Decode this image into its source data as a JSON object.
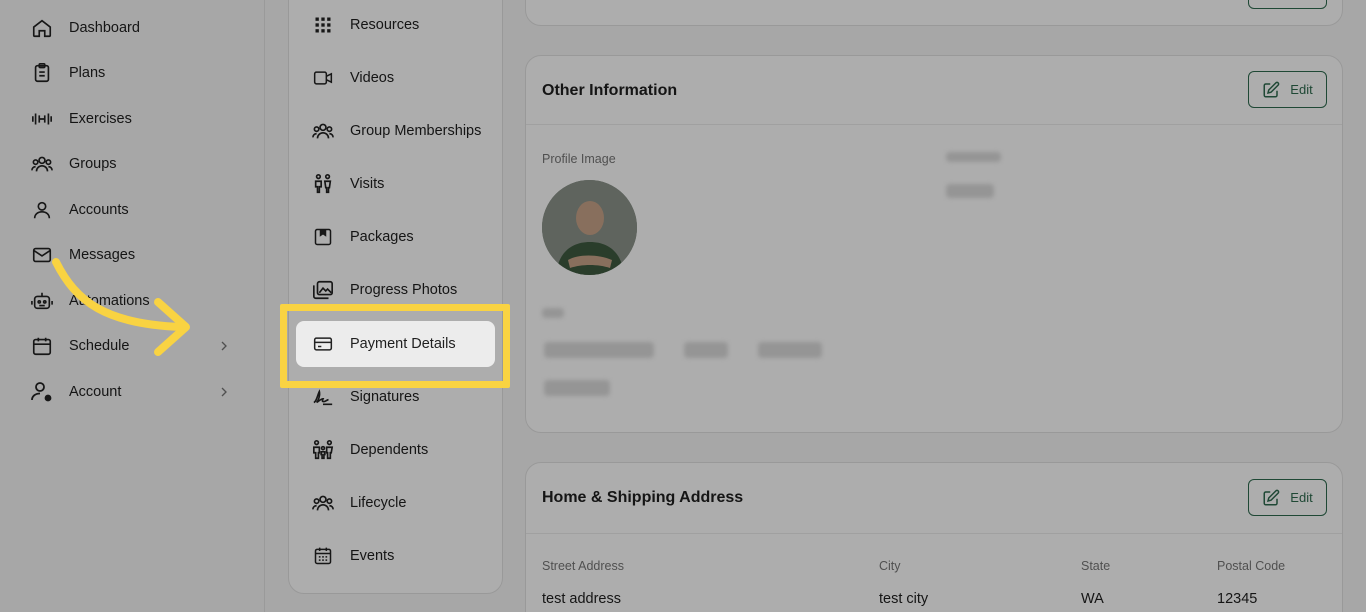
{
  "leftnav": {
    "items": [
      {
        "label": "Dashboard",
        "icon": "home-icon"
      },
      {
        "label": "Plans",
        "icon": "clipboard-icon"
      },
      {
        "label": "Exercises",
        "icon": "dumbbell-icon"
      },
      {
        "label": "Groups",
        "icon": "users-icon"
      },
      {
        "label": "Accounts",
        "icon": "user-icon"
      },
      {
        "label": "Messages",
        "icon": "mail-icon"
      },
      {
        "label": "Automations",
        "icon": "robot-icon"
      },
      {
        "label": "Schedule",
        "icon": "calendar-icon"
      },
      {
        "label": "Account",
        "icon": "user-gear-icon"
      }
    ]
  },
  "submenu": {
    "items": [
      {
        "label": "Resources",
        "icon": "grid-icon"
      },
      {
        "label": "Videos",
        "icon": "video-icon"
      },
      {
        "label": "Group Memberships",
        "icon": "users-icon"
      },
      {
        "label": "Visits",
        "icon": "people-icon"
      },
      {
        "label": "Packages",
        "icon": "package-icon"
      },
      {
        "label": "Progress Photos",
        "icon": "photos-icon"
      },
      {
        "label": "Payment Details",
        "icon": "credit-card-icon"
      },
      {
        "label": "Signatures",
        "icon": "signature-icon"
      },
      {
        "label": "Dependents",
        "icon": "family-icon"
      },
      {
        "label": "Lifecycle",
        "icon": "users-icon"
      },
      {
        "label": "Events",
        "icon": "calendar-grid-icon"
      }
    ],
    "active": "Payment Details"
  },
  "other_info": {
    "title": "Other Information",
    "edit_label": "Edit",
    "profile_image_label": "Profile Image"
  },
  "address": {
    "title": "Home & Shipping Address",
    "edit_label": "Edit",
    "columns": [
      "Street Address",
      "City",
      "State",
      "Postal Code"
    ],
    "values": [
      "test address",
      "test city",
      "WA",
      "12345"
    ]
  },
  "colors": {
    "accent": "#2f6b4f",
    "highlight": "#f9d342"
  }
}
